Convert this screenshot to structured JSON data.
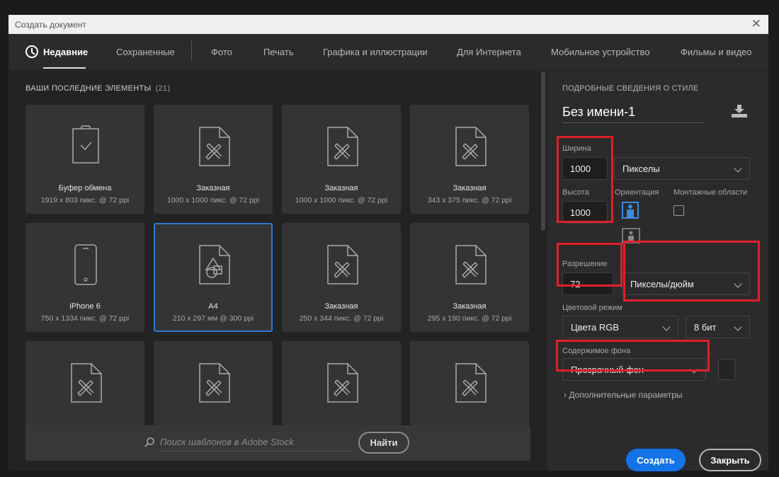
{
  "window": {
    "title": "Создать документ"
  },
  "tabs": [
    {
      "label": "Недавние",
      "active": true
    },
    {
      "label": "Сохраненные"
    },
    {
      "label": "Фото"
    },
    {
      "label": "Печать"
    },
    {
      "label": "Графика и иллюстрации"
    },
    {
      "label": "Для Интернета"
    },
    {
      "label": "Мобильное устройство"
    },
    {
      "label": "Фильмы и видео"
    }
  ],
  "recent": {
    "title": "ВАШИ ПОСЛЕДНИЕ ЭЛЕМЕНТЫ",
    "count": "(21)",
    "items": [
      {
        "name": "Буфер обмена",
        "meta": "1919 x 803 пикс. @ 72 ppi",
        "icon": "clipboard-icon"
      },
      {
        "name": "Заказная",
        "meta": "1000 x 1000 пикс. @ 72 ppi",
        "icon": "custom-doc-icon"
      },
      {
        "name": "Заказная",
        "meta": "1000 x 1000 пикс. @ 72 ppi",
        "icon": "custom-doc-icon"
      },
      {
        "name": "Заказная",
        "meta": "343 x 375 пикс. @ 72 ppi",
        "icon": "custom-doc-icon"
      },
      {
        "name": "iPhone 6",
        "meta": "750 x 1334 пикс. @ 72 ppi",
        "icon": "phone-icon"
      },
      {
        "name": "A4",
        "meta": "210 x 297 мм @ 300 ppi",
        "icon": "shapes-doc-icon",
        "selected": true
      },
      {
        "name": "Заказная",
        "meta": "250 x 344 пикс. @ 72 ppi",
        "icon": "custom-doc-icon"
      },
      {
        "name": "Заказная",
        "meta": "295 x 190 пикс. @ 72 ppi",
        "icon": "custom-doc-icon"
      }
    ]
  },
  "search": {
    "placeholder": "Поиск шаблонов в Adobe Stock",
    "button": "Найти"
  },
  "details": {
    "title": "ПОДРОБНЫЕ СВЕДЕНИЯ О СТИЛЕ",
    "doc_name": "Без имени-1",
    "width_label": "Ширина",
    "width_value": "1000",
    "unit": "Пикселы",
    "height_label": "Высота",
    "height_value": "1000",
    "orientation_label": "Ориентация",
    "artboards_label": "Монтажные области",
    "resolution_label": "Разрешение",
    "resolution_value": "72",
    "resolution_unit": "Пикселы/дюйм",
    "color_mode_label": "Цветовой режим",
    "color_mode": "Цвета RGB",
    "bit_depth": "8 бит",
    "background_label": "Содержимое фона",
    "background": "Прозрачный фон",
    "advanced": "Дополнительные параметры"
  },
  "buttons": {
    "create": "Создать",
    "close": "Закрыть"
  },
  "colors": {
    "accent": "#1473e6",
    "highlight": "#e0202a",
    "selected_border": "#2e7bd6"
  }
}
